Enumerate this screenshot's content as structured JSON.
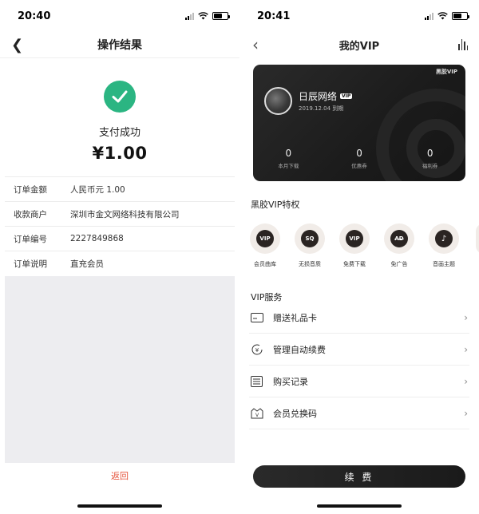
{
  "left": {
    "status_time": "20:40",
    "title": "操作结果",
    "pay_status": "支付成功",
    "amount": "¥1.00",
    "rows": [
      {
        "label": "订单金额",
        "value": "人民币元 1.00"
      },
      {
        "label": "收款商户",
        "value": "深圳市金文网络科技有限公司"
      },
      {
        "label": "订单编号",
        "value": "2227849868"
      },
      {
        "label": "订单说明",
        "value": "直充会员"
      }
    ],
    "return_label": "返回"
  },
  "right": {
    "status_time": "20:41",
    "title": "我的VIP",
    "card": {
      "brand": "黑胶VIP",
      "username": "日辰网络",
      "vip_tag": "VIP",
      "expire": "2019.12.04 到期",
      "stats": [
        {
          "value": "0",
          "label": "本月下载"
        },
        {
          "value": "0",
          "label": "优惠券"
        },
        {
          "value": "0",
          "label": "福利券"
        }
      ]
    },
    "privileges_title": "黑胶VIP特权",
    "privileges": [
      {
        "icon": "VIP",
        "label": "会员曲库"
      },
      {
        "icon": "SQ",
        "label": "无损音质"
      },
      {
        "icon": "VIP",
        "label": "免费下载"
      },
      {
        "icon": "AD",
        "label": "免广告"
      },
      {
        "icon": "♪",
        "label": "音画主题"
      }
    ],
    "services_title": "VIP服务",
    "services": [
      {
        "icon": "gift-card-icon",
        "label": "赠送礼品卡"
      },
      {
        "icon": "auto-renew-icon",
        "label": "管理自动续费"
      },
      {
        "icon": "purchase-record-icon",
        "label": "购买记录"
      },
      {
        "icon": "redeem-code-icon",
        "label": "会员兑换码"
      }
    ],
    "renew_label": "续 费"
  }
}
